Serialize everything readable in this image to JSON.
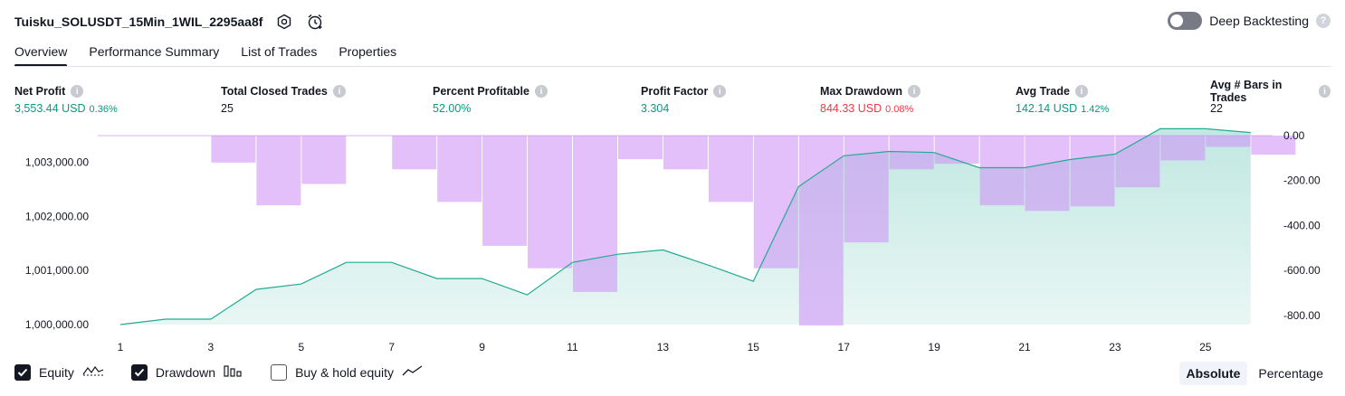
{
  "header": {
    "strategy_name": "Tuisku_SOLUSDT_15Min_1WIL_2295aa8f",
    "deep_backtesting_label": "Deep Backtesting",
    "deep_backtesting_enabled": false
  },
  "tabs": [
    {
      "label": "Overview",
      "active": true
    },
    {
      "label": "Performance Summary",
      "active": false
    },
    {
      "label": "List of Trades",
      "active": false
    },
    {
      "label": "Properties",
      "active": false
    }
  ],
  "stats": {
    "net_profit": {
      "label": "Net Profit",
      "value": "3,553.44 USD",
      "pct": "0.36%"
    },
    "total_closed_trades": {
      "label": "Total Closed Trades",
      "value": "25"
    },
    "percent_profitable": {
      "label": "Percent Profitable",
      "value": "52.00%"
    },
    "profit_factor": {
      "label": "Profit Factor",
      "value": "3.304"
    },
    "max_drawdown": {
      "label": "Max Drawdown",
      "value": "844.33 USD",
      "pct": "0.08%"
    },
    "avg_trade": {
      "label": "Avg Trade",
      "value": "142.14 USD",
      "pct": "1.42%"
    },
    "avg_bars": {
      "label": "Avg # Bars in Trades",
      "value": "22"
    }
  },
  "colors": {
    "equity_line": "#22ab94",
    "equity_fill": "#c8ebe2",
    "drawdown_bar": "#ce93f7",
    "positive": "#089981",
    "negative": "#f23645"
  },
  "chart_data": {
    "type": "line",
    "x_tick_labels": [
      "1",
      "3",
      "5",
      "7",
      "9",
      "11",
      "13",
      "15",
      "17",
      "19",
      "21",
      "23",
      "25"
    ],
    "y_left_tick_labels": [
      "1,003,000.00",
      "1,002,000.00",
      "1,001,000.00",
      "1,000,000.00"
    ],
    "y_left_ticks": [
      1003000,
      1002000,
      1001000,
      1000000
    ],
    "y_left_range": [
      1000000,
      1003600
    ],
    "y_right_tick_labels": [
      "0.00",
      "-200.00",
      "-400.00",
      "-600.00",
      "-800.00"
    ],
    "y_right_ticks": [
      0,
      -200,
      -400,
      -600,
      -800
    ],
    "y_right_range": [
      -844.33,
      0
    ],
    "x": [
      1,
      2,
      3,
      4,
      5,
      6,
      7,
      8,
      9,
      10,
      11,
      12,
      13,
      14,
      15,
      16,
      17,
      18,
      19,
      20,
      21,
      22,
      23,
      24,
      25,
      26
    ],
    "series": [
      {
        "name": "Equity",
        "type": "area",
        "values": [
          1000000,
          1000100,
          1000100,
          1000650,
          1000750,
          1001150,
          1001150,
          1000850,
          1000850,
          1000550,
          1001150,
          1001300,
          1001380,
          1001100,
          1000800,
          1002550,
          1003120,
          1003200,
          1003180,
          1002900,
          1002900,
          1003050,
          1003150,
          1003620,
          1003620,
          1003550
        ]
      },
      {
        "name": "Drawdown",
        "type": "bar",
        "values": [
          0,
          0,
          -120,
          -310,
          -215,
          0,
          -150,
          -295,
          -490,
          -590,
          -695,
          -105,
          -150,
          -295,
          -590,
          -844.33,
          -475,
          -150,
          -125,
          -310,
          -335,
          -315,
          -230,
          -110,
          -50,
          -85
        ]
      }
    ],
    "grid": false
  },
  "legend": {
    "equity": {
      "label": "Equity",
      "checked": true
    },
    "drawdown": {
      "label": "Drawdown",
      "checked": true
    },
    "buy_hold": {
      "label": "Buy & hold equity",
      "checked": false
    }
  },
  "modes": {
    "absolute": {
      "label": "Absolute",
      "active": true
    },
    "percentage": {
      "label": "Percentage",
      "active": false
    }
  }
}
